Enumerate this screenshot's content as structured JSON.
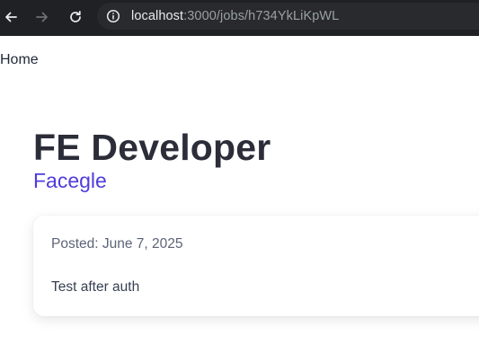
{
  "browser": {
    "url_host": "localhost",
    "url_path": ":3000/jobs/h734YkLiKpWL"
  },
  "nav": {
    "home_label": "Home"
  },
  "job": {
    "title": "FE Developer",
    "company": "Facegle",
    "posted": "Posted: June 7, 2025",
    "description": "Test after auth"
  },
  "colors": {
    "browser_chrome": "#202124",
    "company_accent": "#4f3ddb",
    "title_text": "#2b2d38"
  },
  "icons": {
    "back": "arrow-left-icon",
    "forward": "arrow-right-icon",
    "reload": "reload-icon",
    "site_info": "info-circle-icon"
  }
}
